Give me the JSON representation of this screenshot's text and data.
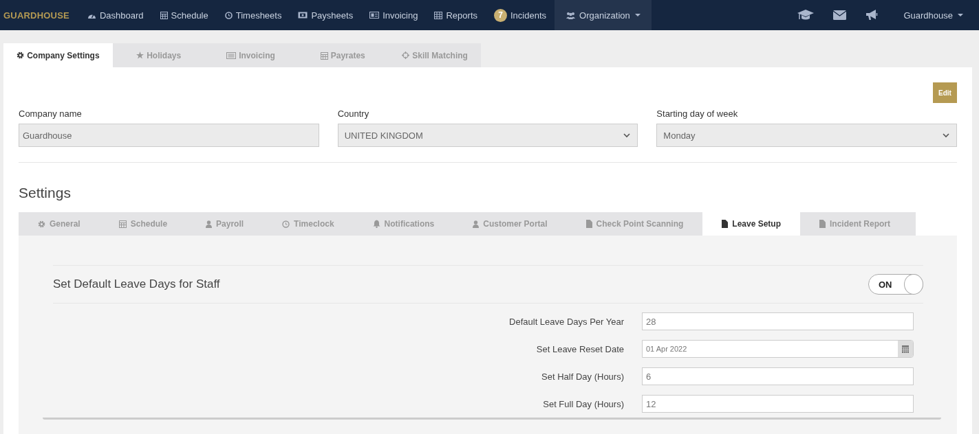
{
  "navbar": {
    "brand": "GUARDHOUSE",
    "items": [
      {
        "label": "Dashboard",
        "kind": "link",
        "selected": false
      },
      {
        "label": "Schedule",
        "kind": "link",
        "selected": false
      },
      {
        "label": "Timesheets",
        "kind": "link",
        "selected": false
      },
      {
        "label": "Paysheets",
        "kind": "link",
        "selected": false
      },
      {
        "label": "Invoicing",
        "kind": "link",
        "selected": false
      },
      {
        "label": "Reports",
        "kind": "link",
        "selected": false
      },
      {
        "label": "Incidents",
        "kind": "badge",
        "badge": "7",
        "selected": false
      },
      {
        "label": "Organization",
        "kind": "dropdown",
        "selected": true
      }
    ],
    "user_menu": "Guardhouse"
  },
  "top_tabs": [
    {
      "label": "Company Settings",
      "selected": true
    },
    {
      "label": "Holidays",
      "selected": false
    },
    {
      "label": "Invoicing",
      "selected": false
    },
    {
      "label": "Payrates",
      "selected": false
    },
    {
      "label": "Skill Matching",
      "selected": false
    }
  ],
  "edit_button": "Edit",
  "fields": [
    {
      "label": "Company name",
      "value": "Guardhouse",
      "kind": "text"
    },
    {
      "label": "Country",
      "value": "UNITED KINGDOM",
      "kind": "select"
    },
    {
      "label": "Starting day of week",
      "value": "Monday",
      "kind": "select"
    }
  ],
  "settings_title": "Settings",
  "settings_tabs": [
    {
      "label": "General",
      "selected": false
    },
    {
      "label": "Schedule",
      "selected": false
    },
    {
      "label": "Payroll",
      "selected": false
    },
    {
      "label": "Timeclock",
      "selected": false
    },
    {
      "label": "Notifications",
      "selected": false
    },
    {
      "label": "Customer Portal",
      "selected": false
    },
    {
      "label": "Check Point Scanning",
      "selected": false
    },
    {
      "label": "Leave Setup",
      "selected": true
    },
    {
      "label": "Incident Report",
      "selected": false
    }
  ],
  "leave_setup": {
    "title": "Set Default Leave Days for Staff",
    "toggle": {
      "label": "ON",
      "on": true
    },
    "rows": [
      {
        "label": "Default Leave Days Per Year",
        "value": "28",
        "kind": "text"
      },
      {
        "label": "Set Leave Reset Date",
        "value": "01 Apr 2022",
        "kind": "date"
      },
      {
        "label": "Set Half Day (Hours)",
        "value": "6",
        "kind": "text"
      },
      {
        "label": "Set Full Day (Hours)",
        "value": "12",
        "kind": "text"
      }
    ]
  }
}
